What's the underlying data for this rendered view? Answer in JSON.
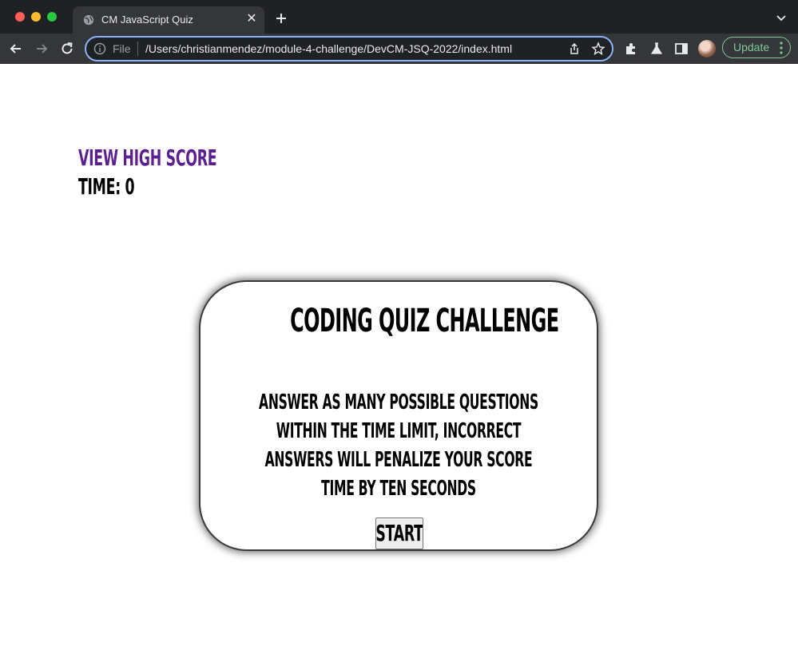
{
  "browser": {
    "tab_title": "CM JavaScript Quiz",
    "tab_close": "✕",
    "address_scheme": "File",
    "address_url": "/Users/christianmendez/module-4-challenge/DevCM-JSQ-2022/index.html",
    "update_label": "Update"
  },
  "page": {
    "high_score_link": "View High Score",
    "timer_label": "Time: 0"
  },
  "quiz_card": {
    "title": "Coding Quiz Challenge",
    "description": "Answer as many possible questions within the time limit, incorrect answers will penalize your score time by ten seconds",
    "start_button": "Start"
  },
  "colors": {
    "chrome_dark": "#202124",
    "toolbar": "#35363a",
    "omnibox_focus": "#8ab4f8",
    "update_green": "#81c995",
    "high_score_purple": "#5b1f8f"
  },
  "icons": [
    "globe-icon",
    "close-icon",
    "plus-icon",
    "chevron-down-icon",
    "back-arrow-icon",
    "forward-arrow-icon",
    "reload-icon",
    "info-icon",
    "share-icon",
    "star-icon",
    "puzzle-icon",
    "flask-icon",
    "sidebar-icon",
    "kebab-menu-icon"
  ]
}
